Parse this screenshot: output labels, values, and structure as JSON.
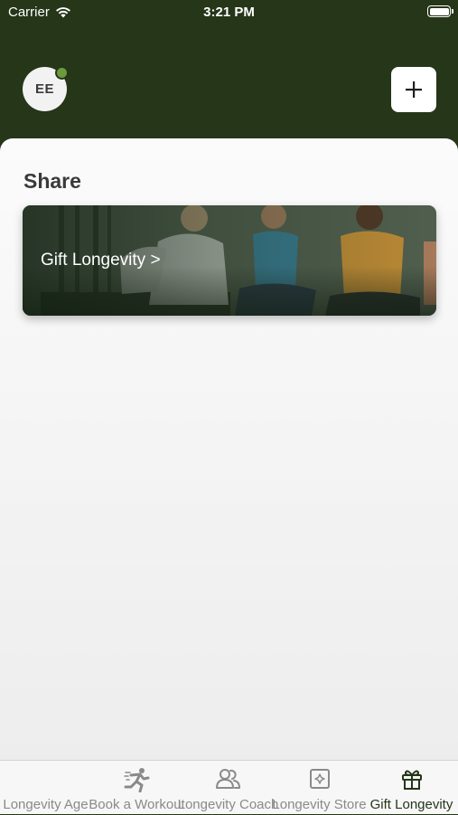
{
  "status_bar": {
    "carrier": "Carrier",
    "time": "3:21 PM"
  },
  "header": {
    "avatar_initials": "EE",
    "add_icon": "plus-icon"
  },
  "main": {
    "section_title": "Share",
    "card": {
      "label": "Gift Longevity >"
    }
  },
  "tab_bar": {
    "items": [
      {
        "label": "Longevity Age",
        "icon": "none",
        "active": false
      },
      {
        "label": "Book a Workout",
        "icon": "runner-icon",
        "active": false
      },
      {
        "label": "Longevity Coach",
        "icon": "people-icon",
        "active": false
      },
      {
        "label": "Longevity Store",
        "icon": "store-icon",
        "active": false
      },
      {
        "label": "Gift Longevity",
        "icon": "gift-icon",
        "active": true
      }
    ]
  },
  "colors": {
    "header_background": "#253619",
    "active_tab": "#253619",
    "inactive_tab": "#8a8a8a",
    "online_indicator": "#6c9a3c"
  }
}
